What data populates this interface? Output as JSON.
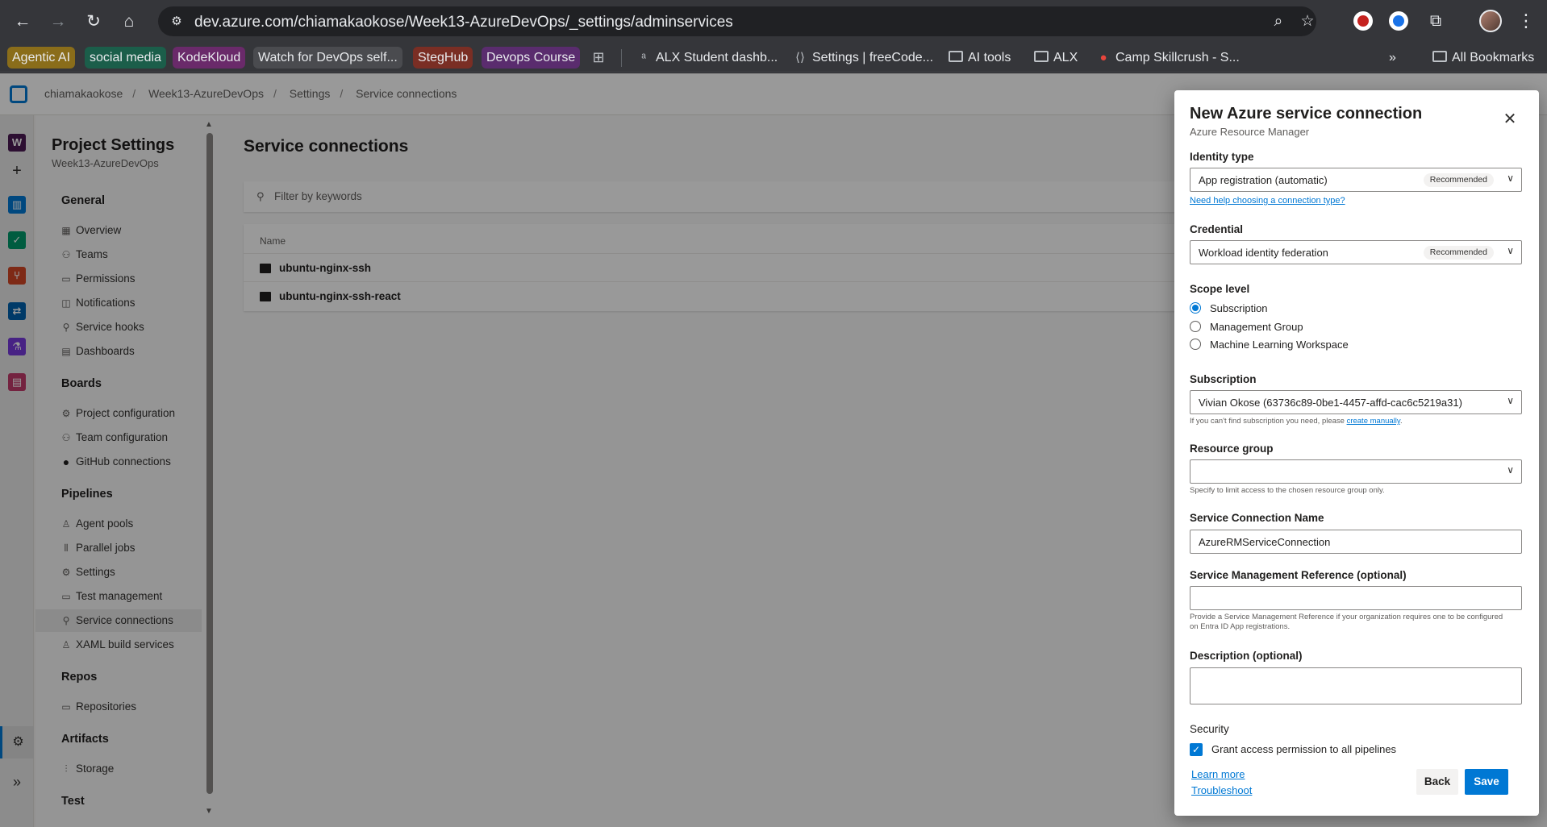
{
  "browser": {
    "url": "dev.azure.com/chiamakaokose/Week13-AzureDevOps/_settings/adminservices",
    "bookmarks": [
      {
        "label": "Agentic AI",
        "bg": "#8a6d1a"
      },
      {
        "label": "social media",
        "bg": "#1b5e4a"
      },
      {
        "label": "KodeKloud",
        "bg": "#6a2a6a"
      },
      {
        "label": "Watch for DevOps self...",
        "bg": "#4a4b4f"
      },
      {
        "label": "StegHub",
        "bg": "#7a2e24"
      },
      {
        "label": "Devops Course",
        "bg": "#5a2c6e"
      },
      {
        "label": "ALX Student dashb..."
      },
      {
        "label": "Settings | freeCode..."
      },
      {
        "label": "AI tools"
      },
      {
        "label": "ALX"
      },
      {
        "label": "Camp Skillcrush - S..."
      },
      {
        "label": "All Bookmarks"
      }
    ]
  },
  "header": {
    "breadcrumb": [
      "chiamakaokose",
      "Week13-AzureDevOps",
      "Settings",
      "Service connections"
    ]
  },
  "rail": {
    "org_initial": "W"
  },
  "nav": {
    "title": "Project Settings",
    "subtitle": "Week13-AzureDevOps",
    "sections": {
      "general": "General",
      "boards": "Boards",
      "pipelines": "Pipelines",
      "repos": "Repos",
      "artifacts": "Artifacts",
      "test": "Test"
    },
    "general_items": [
      "Overview",
      "Teams",
      "Permissions",
      "Notifications",
      "Service hooks",
      "Dashboards"
    ],
    "boards_items": [
      "Project configuration",
      "Team configuration",
      "GitHub connections"
    ],
    "pipelines_items": [
      "Agent pools",
      "Parallel jobs",
      "Settings",
      "Test management",
      "Service connections",
      "XAML build services"
    ],
    "repos_items": [
      "Repositories"
    ],
    "artifacts_items": [
      "Storage"
    ]
  },
  "main": {
    "title": "Service connections",
    "filter_placeholder": "Filter by keywords",
    "column_name": "Name",
    "rows": [
      "ubuntu-nginx-ssh",
      "ubuntu-nginx-ssh-react"
    ]
  },
  "panel": {
    "title": "New Azure service connection",
    "subtitle": "Azure Resource Manager",
    "identity_type_label": "Identity type",
    "identity_type_value": "App registration (automatic)",
    "recommended": "Recommended",
    "help_link": "Need help choosing a connection type?",
    "credential_label": "Credential",
    "credential_value": "Workload identity federation",
    "scope_label": "Scope level",
    "scope_options": [
      "Subscription",
      "Management Group",
      "Machine Learning Workspace"
    ],
    "subscription_label": "Subscription",
    "subscription_value": "Vivian Okose (63736c89-0be1-4457-affd-cac6c5219a31)",
    "subscription_help": "If you can't find subscription you need, please",
    "subscription_help_link": "create manually",
    "resource_group_label": "Resource group",
    "resource_group_value": "",
    "resource_group_help": "Specify to limit access to the chosen resource group only.",
    "connection_name_label": "Service Connection Name",
    "connection_name_value": "AzureRMServiceConnection",
    "smr_label": "Service Management Reference (optional)",
    "smr_value": "",
    "smr_help": "Provide a Service Management Reference if your organization requires one to be configured on Entra ID App registrations.",
    "description_label": "Description (optional)",
    "description_value": "",
    "security_label": "Security",
    "grant_label": "Grant access permission to all pipelines",
    "learn_more": "Learn more",
    "troubleshoot": "Troubleshoot",
    "back": "Back",
    "save": "Save"
  }
}
